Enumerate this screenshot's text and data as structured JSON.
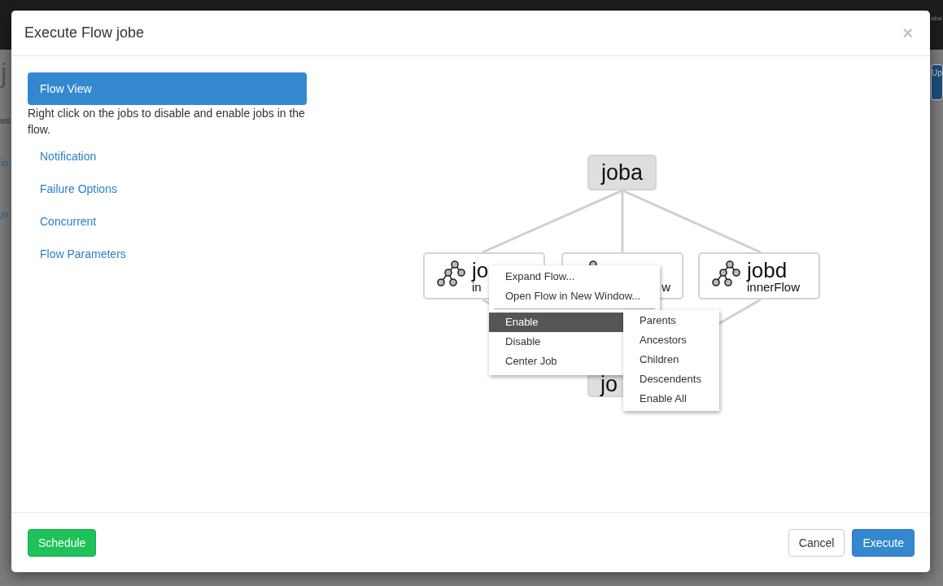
{
  "background": {
    "fragments": [
      "j",
      "ws",
      "in",
      "jo",
      "aba",
      "Up"
    ]
  },
  "dialog": {
    "title": "Execute Flow jobe",
    "close": "×"
  },
  "nav": [
    {
      "label": "Flow View",
      "selected": true,
      "description": "Right click on the jobs to disable and enable jobs in the flow."
    },
    {
      "label": "Notification",
      "selected": false
    },
    {
      "label": "Failure Options",
      "selected": false
    },
    {
      "label": "Concurrent",
      "selected": false
    },
    {
      "label": "Flow Parameters",
      "selected": false
    }
  ],
  "graph": {
    "nodes": [
      {
        "name": "joba",
        "kind": "job"
      },
      {
        "name": "jo",
        "subtitle": "in",
        "kind": "flow"
      },
      {
        "subtitle": "w",
        "kind": "flow"
      },
      {
        "name": "jobd",
        "subtitle": "innerFlow",
        "kind": "flow"
      },
      {
        "name": "jo",
        "kind": "job"
      }
    ],
    "context_menu": {
      "items": [
        {
          "label": "Expand Flow...",
          "selected": false
        },
        {
          "label": "Open Flow in New Window...",
          "selected": false
        },
        {
          "label": "Enable",
          "selected": true
        },
        {
          "label": "Disable",
          "selected": false
        },
        {
          "label": "Center Job",
          "selected": false
        }
      ],
      "submenu": [
        {
          "label": "Parents",
          "selected": false
        },
        {
          "label": "Ancestors",
          "selected": false
        },
        {
          "label": "Children",
          "selected": false
        },
        {
          "label": "Descendents",
          "selected": false
        },
        {
          "label": "Enable All",
          "selected": false
        }
      ]
    }
  },
  "footer": {
    "buttons": [
      {
        "label": "Schedule",
        "kind": "success"
      },
      {
        "label": "Cancel",
        "kind": "default"
      },
      {
        "label": "Execute",
        "kind": "primary"
      }
    ]
  }
}
